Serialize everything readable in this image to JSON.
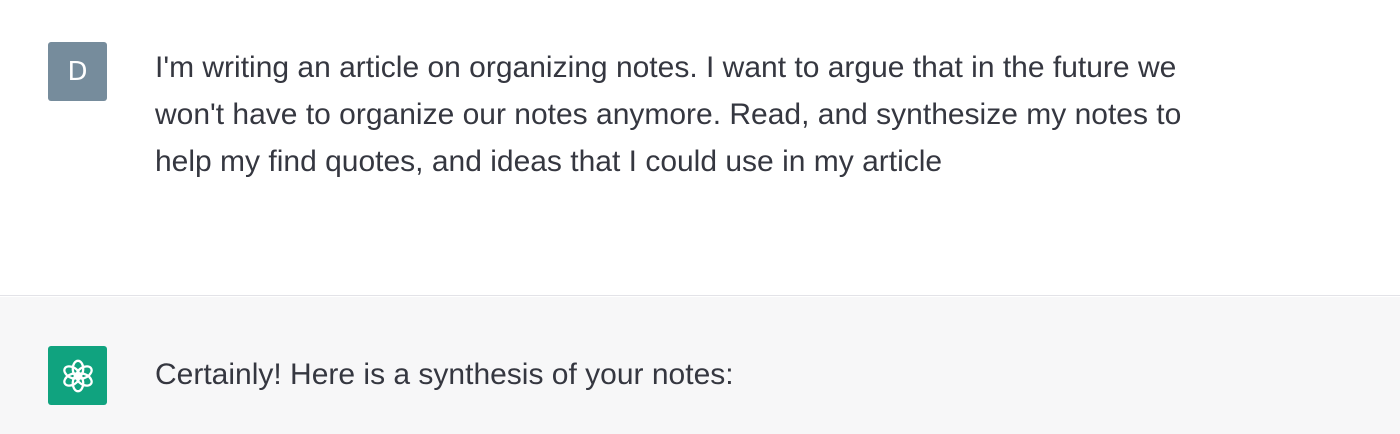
{
  "conversation": {
    "user_message": {
      "avatar_letter": "D",
      "avatar_color": "#768c9c",
      "text": "I'm writing an article on organizing notes. I want to argue that in the future we\nwon't have to organize our notes anymore. Read, and synthesize my notes to\nhelp my find quotes, and ideas that I could use in my article"
    },
    "assistant_message": {
      "avatar_icon": "openai-logo-icon",
      "avatar_color": "#10a37f",
      "text": "Certainly! Here is a synthesis of your notes:"
    }
  }
}
